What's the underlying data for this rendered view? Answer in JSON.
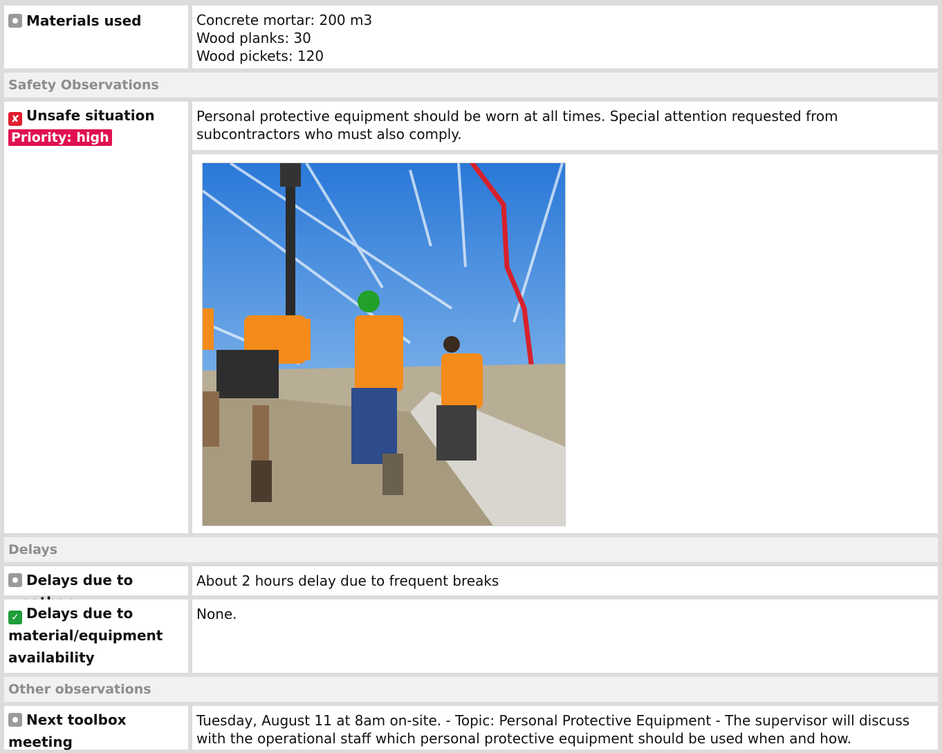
{
  "sections": {
    "safety": "Safety Observations",
    "delays": "Delays",
    "other": "Other observations"
  },
  "rows": {
    "materials": {
      "label": "Materials used",
      "icon": "neutral-dot-icon",
      "lines": [
        "Concrete mortar: 200 m3",
        "Wood planks: 30",
        "Wood pickets: 120"
      ]
    },
    "unsafe": {
      "label": "Unsafe situation",
      "icon": "cross-icon",
      "priority": "Priority: high",
      "text": "Personal protective equipment should be worn at all times. Special attention requested from subcontractors who must also comply."
    },
    "weather": {
      "label": "Delays due to weather",
      "icon": "neutral-dot-icon",
      "text": "About 2 hours delay due to frequent breaks"
    },
    "material_delay": {
      "label": "Delays due to material/equipment availability",
      "icon": "check-icon",
      "text": "None."
    },
    "toolbox": {
      "label": "Next toolbox meeting",
      "icon": "neutral-dot-icon",
      "text": "Tuesday, August 11 at 8am on-site. - Topic: Personal Protective Equipment - The supervisor will discuss with the operational staff which personal protective equipment should be used when and how."
    }
  },
  "colors": {
    "priority_badge": "#e0114f",
    "bad_icon": "#e11d2e",
    "ok_icon": "#1f9d3a",
    "section_bg": "#f1f1f1"
  }
}
